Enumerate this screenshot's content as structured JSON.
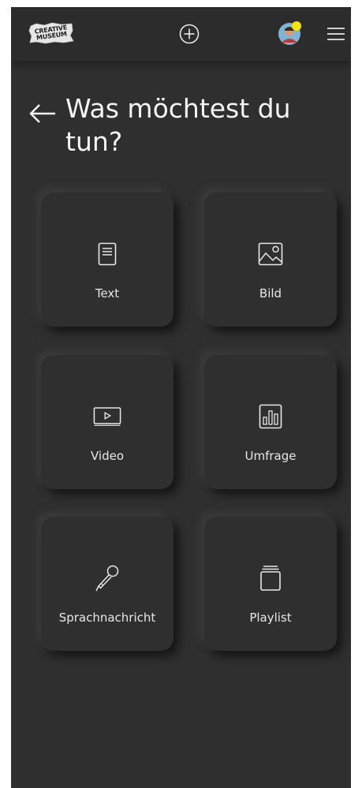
{
  "header": {
    "logo_line1": "CREATIVE",
    "logo_line2": "MUSEUM",
    "logo_text_label": "CREATIVE MUSEUM",
    "icons": {
      "logo": "creative-museum-logo",
      "add": "plus-circle-icon",
      "avatar": "user-avatar",
      "menu": "hamburger-menu-icon"
    },
    "avatar_badge_color": "#f5e400"
  },
  "page": {
    "back_icon": "arrow-left-icon",
    "title": "Was möchtest du tun?"
  },
  "options": [
    {
      "label": "Text",
      "icon": "text-document-icon"
    },
    {
      "label": "Bild",
      "icon": "image-icon"
    },
    {
      "label": "Video",
      "icon": "video-play-icon"
    },
    {
      "label": "Umfrage",
      "icon": "poll-bar-chart-icon"
    },
    {
      "label": "Sprachnachricht",
      "icon": "microphone-icon"
    },
    {
      "label": "Playlist",
      "icon": "playlist-stack-icon"
    }
  ],
  "colors": {
    "background": "#2f2f2f",
    "topbar": "#2c2c2c",
    "text": "#f4f4f4"
  }
}
